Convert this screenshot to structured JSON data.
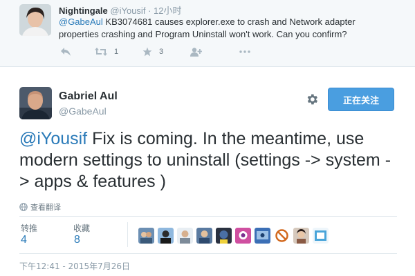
{
  "reply_tweet": {
    "name": "Nightingale",
    "handle": "@iYousif",
    "separator": "·",
    "time": "12小时",
    "mention": "@GabeAul",
    "text": " KB3074681 causes explorer.exe to crash and Network adapter properties crashing and Program Uninstall won't work. Can you confirm?",
    "actions": {
      "reply_icon": "reply-icon",
      "retweet_icon": "retweet-icon",
      "retweet_count": "1",
      "favorite_icon": "star-icon",
      "favorite_count": "3",
      "follow_icon": "follow-user-icon",
      "more_icon": "more-dots-icon"
    }
  },
  "main_tweet": {
    "name": "Gabriel Aul",
    "handle": "@GabeAul",
    "follow_button": "正在关注",
    "settings_icon": "gear-icon",
    "mention": "@iYousif",
    "text": " Fix is coming. In the meantime, use modern settings to uninstall (settings -> system -> apps & features )",
    "translate_label": "查看翻译",
    "stats": {
      "retweets_label": "转推",
      "retweets_value": "4",
      "favorites_label": "收藏",
      "favorites_value": "8"
    },
    "favoriter_avatars_count": 9,
    "timestamp": "下午12:41 - 2015年7月26日"
  },
  "colors": {
    "link": "#2b7bb9",
    "follow_button_bg": "#4a9ee0",
    "reply_bg": "#f5f8fa",
    "muted_text": "#8899a6"
  }
}
